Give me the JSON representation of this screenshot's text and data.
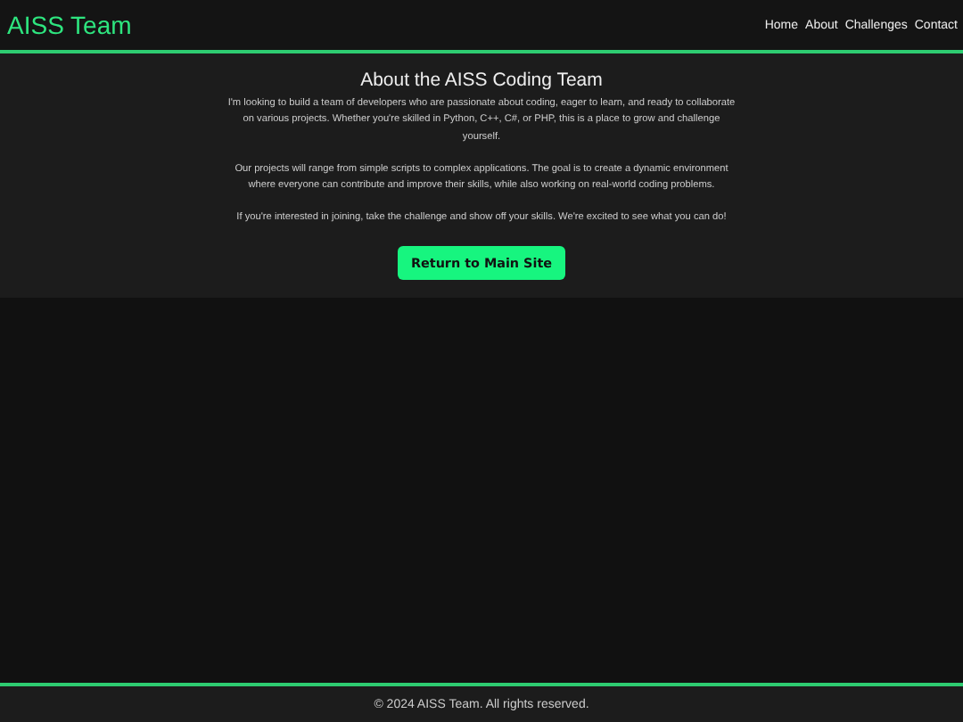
{
  "header": {
    "logo": "AISS Team",
    "nav": [
      {
        "label": "Home"
      },
      {
        "label": "About"
      },
      {
        "label": "Challenges"
      },
      {
        "label": "Contact"
      }
    ]
  },
  "about": {
    "title": "About the AISS Coding Team",
    "paragraphs": [
      "I'm looking to build a team of developers who are passionate about coding, eager to learn, and ready to collaborate on various projects. Whether you're skilled in Python, C++, C#, or PHP, this is a place to grow and challenge yourself.",
      "Our projects will range from simple scripts to complex applications. The goal is to create a dynamic environment where everyone can contribute and improve their skills, while also working on real-world coding problems.",
      "If you're interested in joining, take the challenge and show off your skills. We're excited to see what you can do!"
    ],
    "button": "Return to Main Site"
  },
  "footer": {
    "text": "© 2024 AISS Team. All rights reserved."
  }
}
